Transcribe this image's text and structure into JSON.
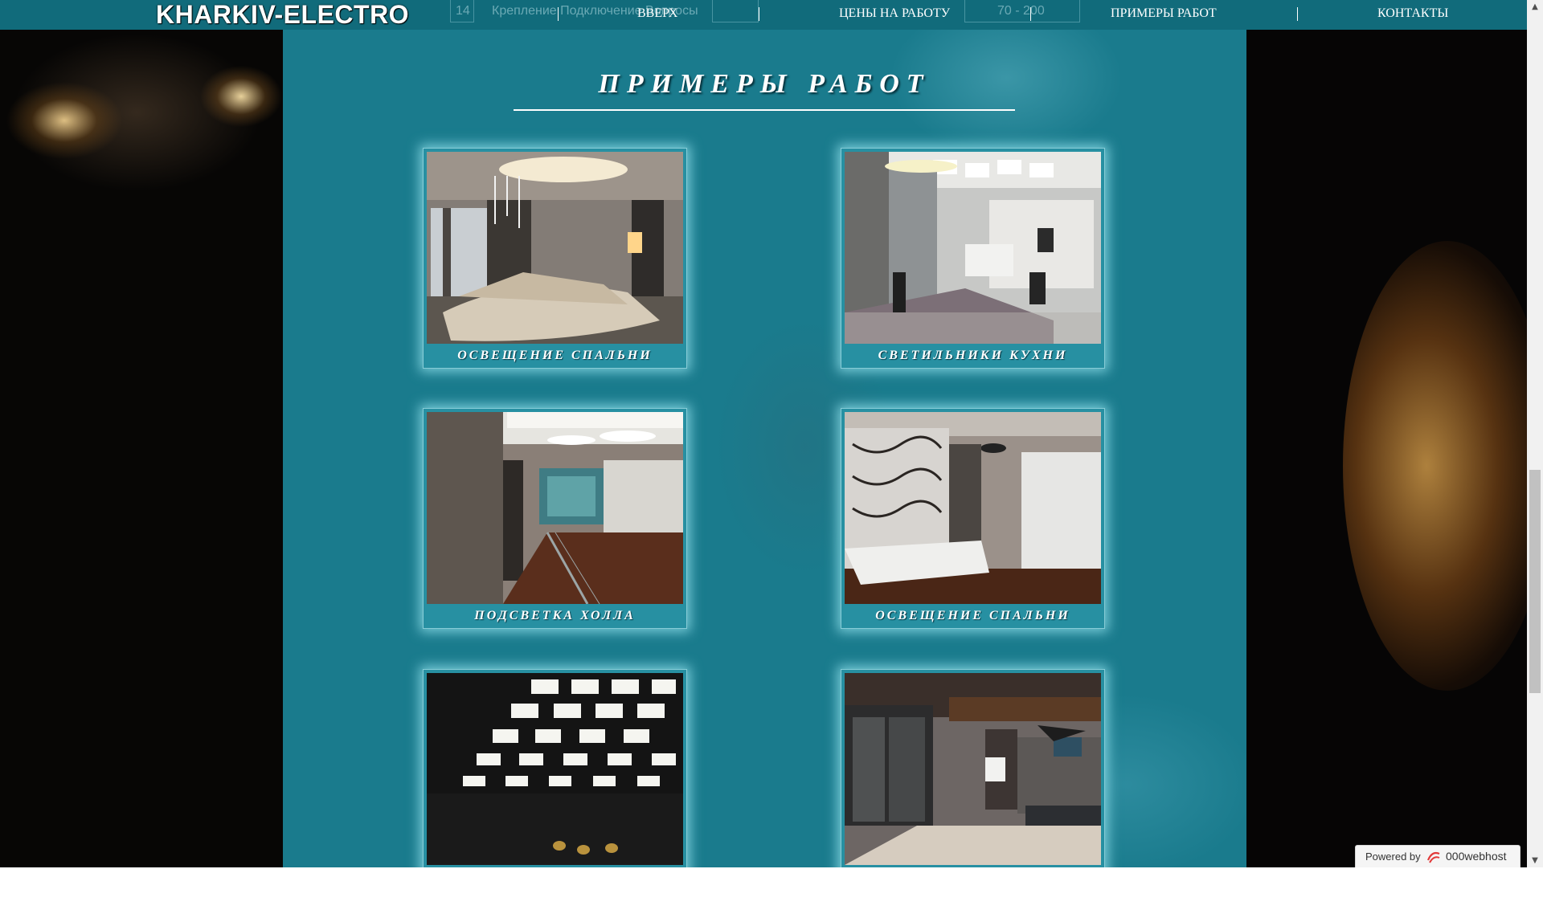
{
  "nav": {
    "logo": "KHARKIV-ELECTRO",
    "ghost_num": "14",
    "ghost_text": "Крепление Подключение Вопросы",
    "ghost_price": "70 - 200",
    "links": [
      "ВВЕРХ",
      "ЦЕНЫ НА РАБОТУ",
      "ПРИМЕРЫ РАБОТ",
      "КОНТАКТЫ"
    ]
  },
  "page": {
    "title": "ПРИМЕРЫ РАБОТ"
  },
  "gallery": [
    {
      "caption": "ОСВЕЩЕНИЕ СПАЛЬНИ"
    },
    {
      "caption": "СВЕТИЛЬНИКИ КУХНИ"
    },
    {
      "caption": "ПОДСВЕТКА ХОЛЛА"
    },
    {
      "caption": "ОСВЕЩЕНИЕ СПАЛЬНИ"
    },
    {
      "caption": ""
    },
    {
      "caption": ""
    }
  ],
  "footer": {
    "powered_by": "Powered by",
    "brand": "000webhost"
  },
  "colors": {
    "teal_panel": "#1a7b8d",
    "navbar": "#116b7b",
    "card": "#2790a2"
  }
}
